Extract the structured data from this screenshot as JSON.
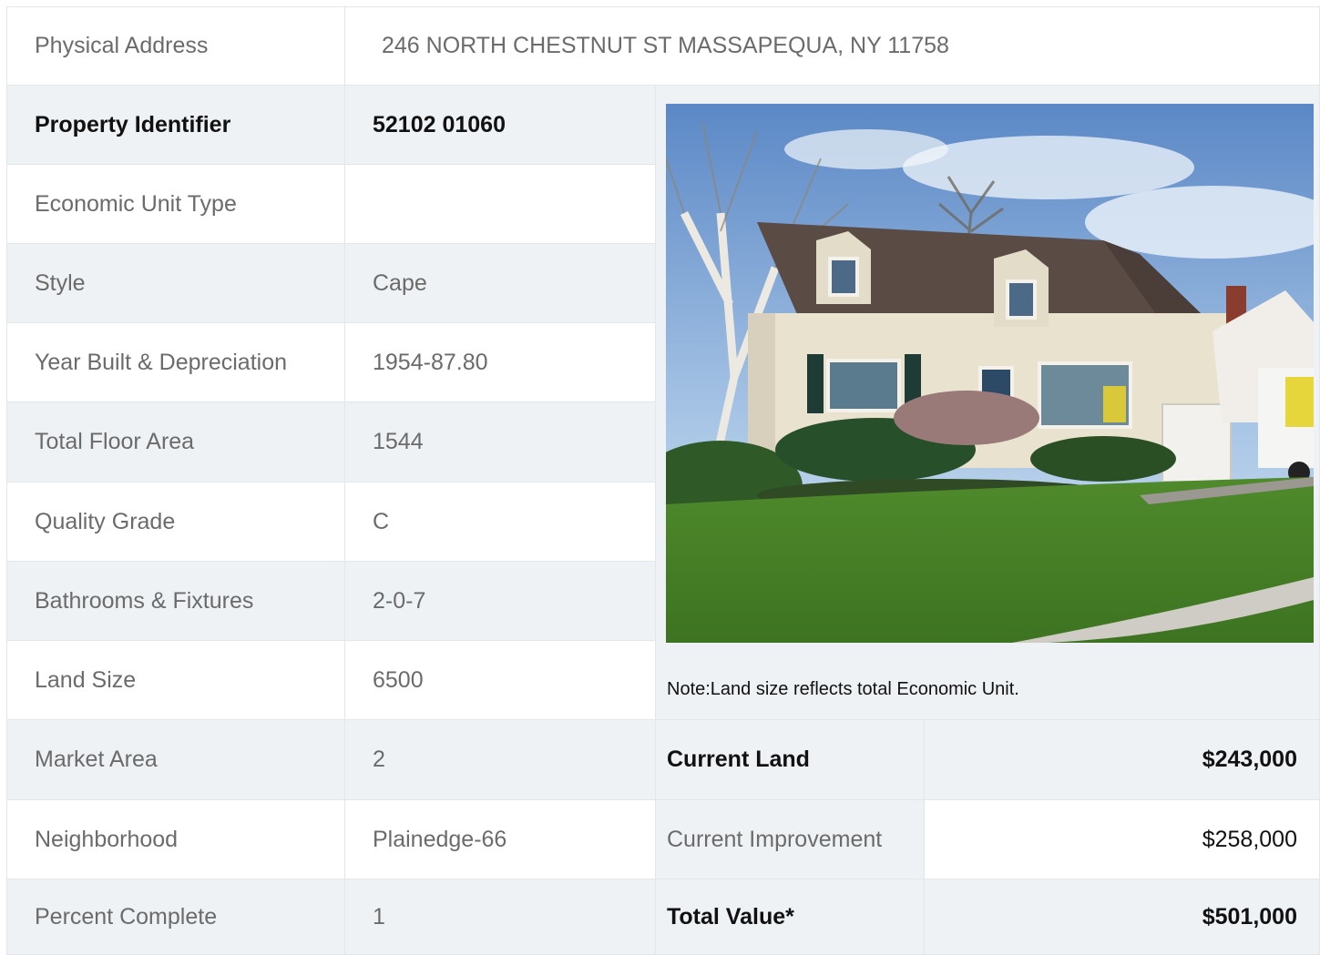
{
  "address": {
    "label": "Physical Address",
    "value": "246  NORTH CHESTNUT ST  MASSAPEQUA, NY  11758"
  },
  "rows": [
    {
      "label": "Property Identifier",
      "value": "52102  01060"
    },
    {
      "label": "Economic Unit Type",
      "value": ""
    },
    {
      "label": "Style",
      "value": "Cape"
    },
    {
      "label": "Year Built & Depreciation",
      "value": "1954-87.80"
    },
    {
      "label": "Total Floor Area",
      "value": "1544"
    },
    {
      "label": "Quality Grade",
      "value": "C"
    },
    {
      "label": "Bathrooms & Fixtures",
      "value": "2-0-7"
    },
    {
      "label": "Land Size",
      "value": "6500"
    },
    {
      "label": "Market Area",
      "value": "2"
    },
    {
      "label": "Neighborhood",
      "value": "Plainedge-66"
    },
    {
      "label": "Percent Complete",
      "value": "1"
    }
  ],
  "note": "Note:Land size reflects total Economic Unit.",
  "values": [
    {
      "label": "Current Land",
      "value": "$243,000"
    },
    {
      "label": "Current Improvement",
      "value": "$258,000"
    },
    {
      "label": "Total Value*",
      "value": "$501,000"
    }
  ]
}
